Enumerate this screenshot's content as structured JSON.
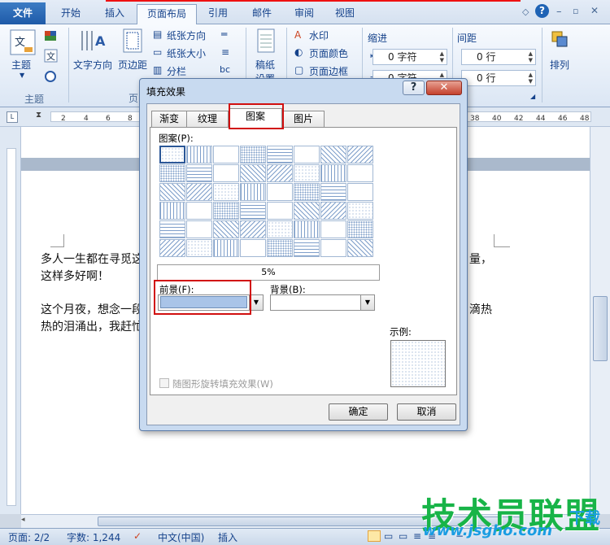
{
  "menu": {
    "tabs": [
      "文件",
      "开始",
      "插入",
      "页面布局",
      "引用",
      "邮件",
      "审阅",
      "视图"
    ]
  },
  "ribbon": {
    "themes_label": "主题",
    "themes_group": "主题",
    "text_direction": "文字方向",
    "margins": "页边距",
    "orientation": "纸张方向",
    "size": "纸张大小",
    "columns": "分栏",
    "hyphen": "bc",
    "draft": "稿纸",
    "draft2": "设置",
    "watermark": "水印",
    "page_color": "页面颜色",
    "page_border": "页面边框",
    "indent_label": "缩进",
    "indent_left": "0 字符",
    "indent_right": "0 字符",
    "spacing_label": "间距",
    "spacing_before": "0 行",
    "spacing_after": "0 行",
    "arrange": "排列",
    "page_group": "页"
  },
  "ruler": {
    "h_numbers": [
      "2",
      "4",
      "6",
      "8",
      "38",
      "40",
      "42",
      "44",
      "46",
      "48"
    ]
  },
  "document": {
    "line1": "多人一生都在寻觅这",
    "line1_tail": "量，",
    "line2": "这样多好啊！",
    "line3": "这个月夜，想念一段",
    "line3_tail": "滴热",
    "line4": "热的泪涌出，我赶忙"
  },
  "dialog": {
    "title": "填充效果",
    "help": "?",
    "close": "✕",
    "tabs": [
      "渐变",
      "纹理",
      "图案",
      "图片"
    ],
    "selected_tab": "图案",
    "pattern_label": "图案(P):",
    "pattern_name": "5%",
    "foreground_label": "前景(F):",
    "background_label": "背景(B):",
    "foreground_color": "#a9c4e8",
    "sample_label": "示例:",
    "rotate_label": "随图形旋转填充效果(W)",
    "ok": "确定",
    "cancel": "取消"
  },
  "status": {
    "page": "页面: 2/2",
    "words": "字数: 1,244",
    "lang": "中文(中国)",
    "mode": "插入",
    "zoom_minus": "−"
  },
  "watermark": {
    "brand": "技术员联盟",
    "url": "www.jsgho.com",
    "download": "下载"
  },
  "colors": {
    "accent": "#2b5797",
    "highlight_box": "#d10f0f"
  }
}
